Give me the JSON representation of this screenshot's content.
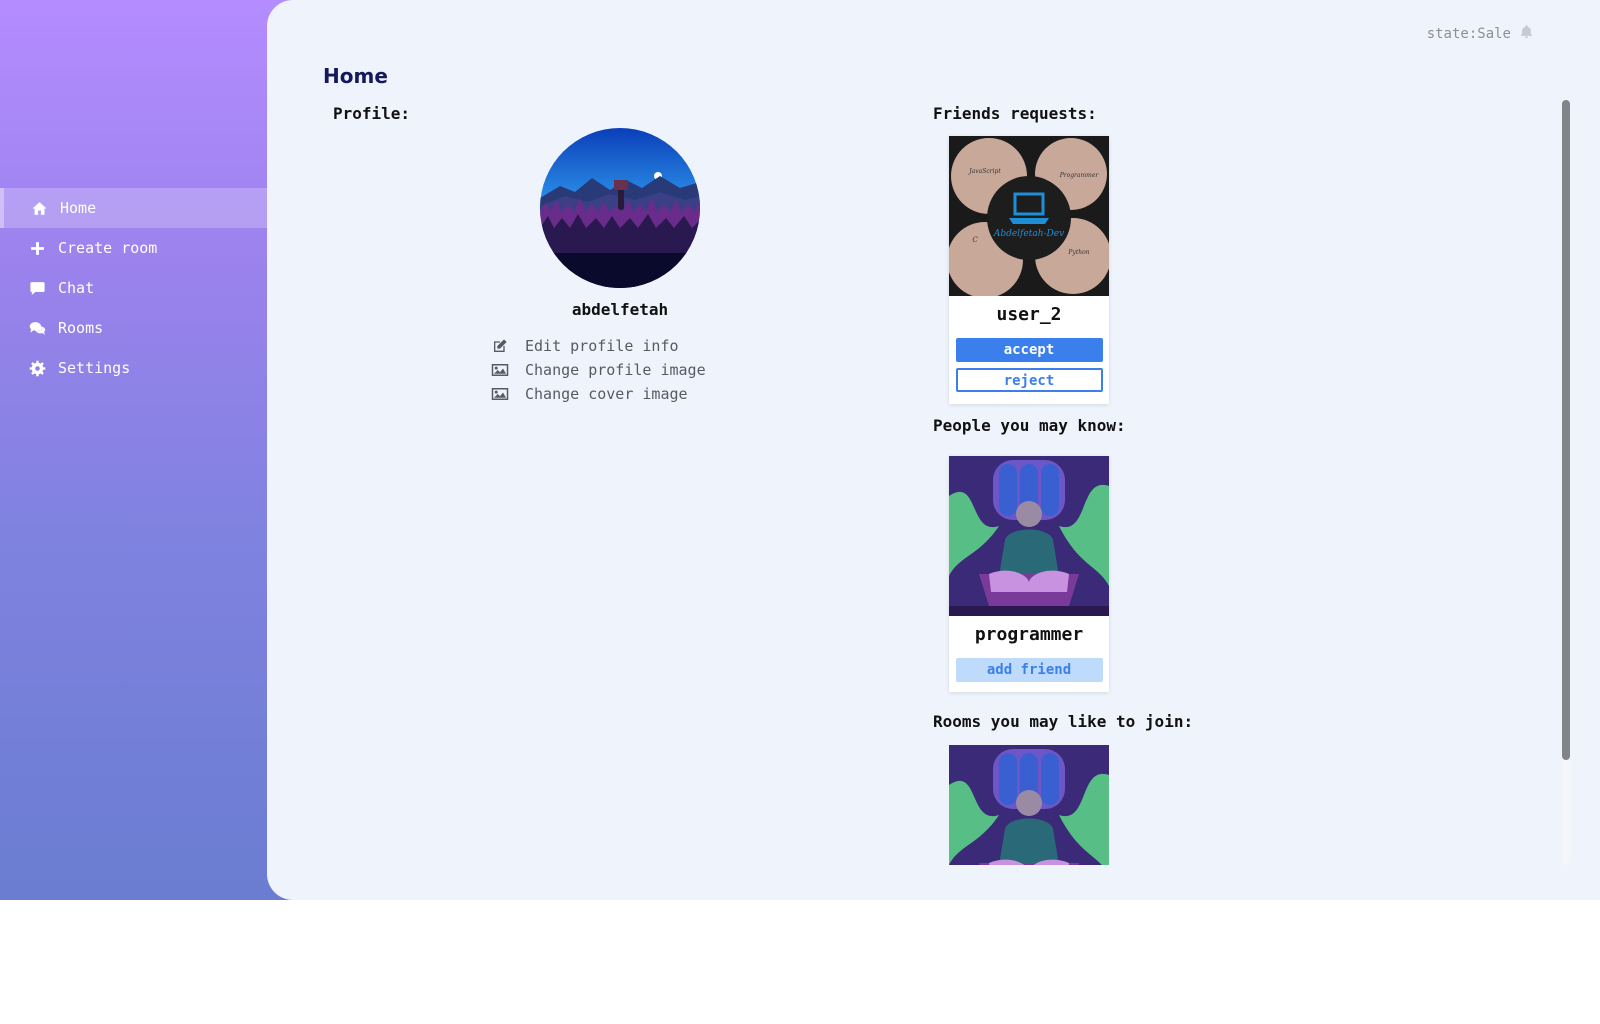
{
  "header": {
    "state_text": "state:Sale",
    "bell_icon": "bell-icon"
  },
  "page": {
    "title": "Home"
  },
  "sidebar": {
    "items": [
      {
        "label": "Home",
        "icon": "home-icon",
        "active": true
      },
      {
        "label": "Create room",
        "icon": "plus-icon"
      },
      {
        "label": "Chat",
        "icon": "chat-icon"
      },
      {
        "label": "Rooms",
        "icon": "comments-icon"
      },
      {
        "label": "Settings",
        "icon": "gear-icon"
      }
    ]
  },
  "profile": {
    "section_label": "Profile:",
    "username": "abdelfetah",
    "actions": [
      {
        "label": "Edit profile info",
        "icon": "edit-icon"
      },
      {
        "label": "Change profile image",
        "icon": "image-icon"
      },
      {
        "label": "Change cover image",
        "icon": "image-icon"
      }
    ]
  },
  "friend_requests": {
    "section_label": "Friends requests:",
    "items": [
      {
        "name": "user_2",
        "accept_label": "accept",
        "reject_label": "reject"
      }
    ]
  },
  "people": {
    "section_label": "People you may know:",
    "items": [
      {
        "name": "programmer",
        "add_label": "add friend"
      }
    ]
  },
  "rooms": {
    "section_label": "Rooms you may like to join:"
  },
  "logo_texts": {
    "center": "Abdelfetah-Dev",
    "top_left": "JavaScript",
    "top_right": "Programmer",
    "bottom_left": "C",
    "bottom_right": "Python"
  },
  "colors": {
    "sidebar_gradient_top": "#b48cff",
    "sidebar_gradient_bottom": "#6a7dd0",
    "main_bg": "#eff4fc",
    "title": "#15185c",
    "accent": "#3b7fec",
    "add_friend_bg": "#bfdbfc"
  }
}
